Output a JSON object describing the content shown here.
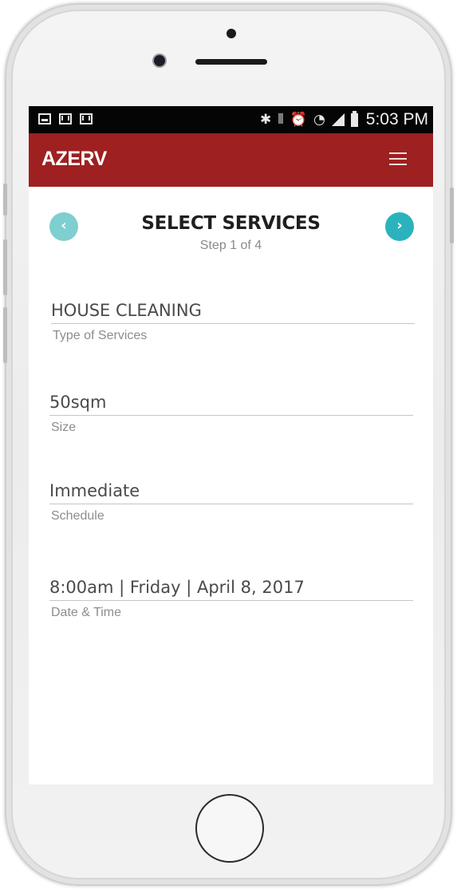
{
  "status_bar": {
    "left_icons": [
      "image-icon",
      "mail-icon",
      "mail-icon"
    ],
    "right_icons": [
      "bluetooth-icon",
      "vibrate-icon",
      "alarm-icon",
      "wifi-icon",
      "signal-icon",
      "battery-icon"
    ],
    "time": "5:03 PM"
  },
  "app_bar": {
    "brand": "AZERV",
    "brand_color": "#9e2020",
    "menu_icon": "hamburger-menu-icon"
  },
  "header": {
    "title": "SELECT SERVICES",
    "step": "Step 1 of 4",
    "prev_icon": "chevron-left-icon",
    "next_icon": "chevron-right-icon",
    "prev_color": "#7fcfd0",
    "next_color": "#2bb3bd"
  },
  "fields": [
    {
      "value": "HOUSE CLEANING",
      "label": "Type of Services"
    },
    {
      "value": "50sqm",
      "label": "Size"
    },
    {
      "value": "Immediate",
      "label": "Schedule"
    },
    {
      "value": "8:00am | Friday | April 8, 2017",
      "label": "Date & Time"
    }
  ]
}
